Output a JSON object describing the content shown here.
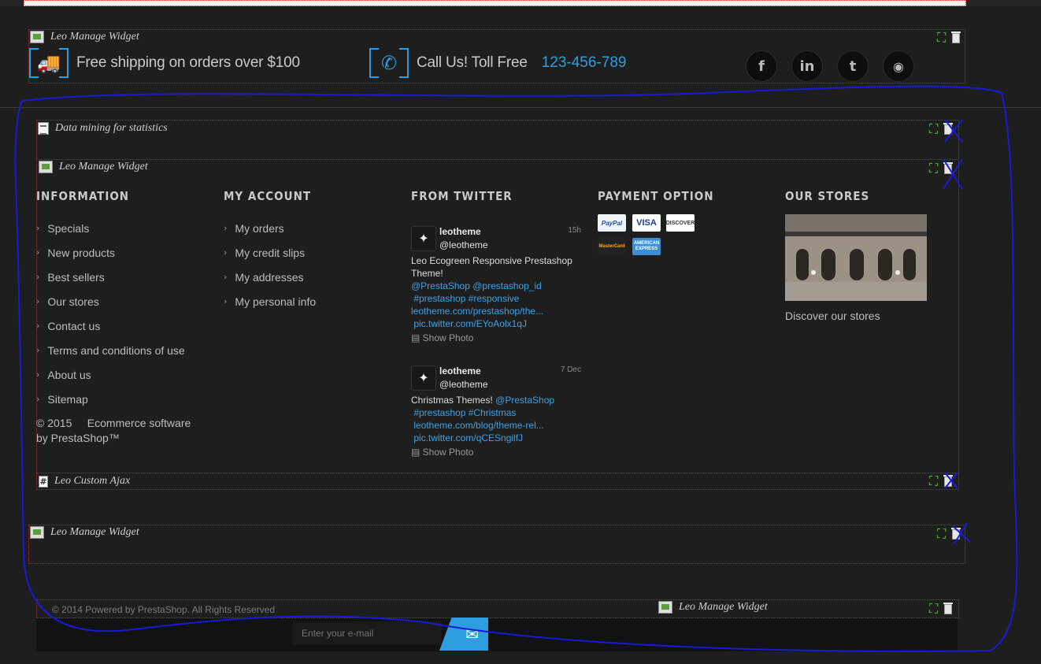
{
  "widgets": {
    "manage": "Leo Manage Widget",
    "data_mining": "Data mining for statistics",
    "custom_ajax": "Leo Custom Ajax"
  },
  "header": {
    "shipping_text": "Free shipping on orders over $100",
    "call_text": "Call Us! Toll Free",
    "phone": "123-456-789",
    "social": [
      "f",
      "in",
      "t",
      "rss"
    ]
  },
  "footer": {
    "information": {
      "title": "INFORMATION",
      "items": [
        "Specials",
        "New products",
        "Best sellers",
        "Our stores",
        "Contact us",
        "Terms and conditions of use",
        "About us",
        "Sitemap"
      ],
      "copyright_line1": "© 2015     Ecommerce software",
      "copyright_line2": "by PrestaShop™"
    },
    "account": {
      "title": "MY ACCOUNT",
      "items": [
        "My orders",
        "My credit slips",
        "My addresses",
        "My personal info"
      ]
    },
    "twitter": {
      "title": "FROM TWITTER",
      "tweets": [
        {
          "name": "leotheme",
          "handle": "@leotheme",
          "time": "15h",
          "text": "Leo Ecogreen Responsive Prestashop Theme!",
          "links": [
            "@PrestaShop @prestashop_id",
            " #prestashop #responsive",
            "leotheme.com/prestashop/the...",
            " pic.twitter.com/EYoAolx1qJ"
          ],
          "photo": "Show Photo"
        },
        {
          "name": "leotheme",
          "handle": "@leotheme",
          "time": "7 Dec",
          "text": "Christmas Themes!",
          "inline_link": "@PrestaShop",
          "links": [
            " #prestashop #Christmas",
            " leotheme.com/blog/theme-rel...",
            " pic.twitter.com/qCESngilfJ"
          ],
          "photo": "Show Photo"
        }
      ]
    },
    "payment": {
      "title": "PAYMENT OPTION",
      "cards": [
        "PayPal",
        "VISA",
        "DISCOVER",
        "MasterCard",
        "AMERICAN EXPRESS"
      ]
    },
    "stores": {
      "title": "OUR STORES",
      "link": "Discover our stores"
    }
  },
  "bottom": {
    "powered": "© 2014 Powered by PrestaShop. All Rights Reserved",
    "newsletter_placeholder": "Enter your e-mail"
  },
  "colors": {
    "accent": "#2d9ee0",
    "widget_border": "#b3262c",
    "annotation": "#1a1ad6"
  }
}
